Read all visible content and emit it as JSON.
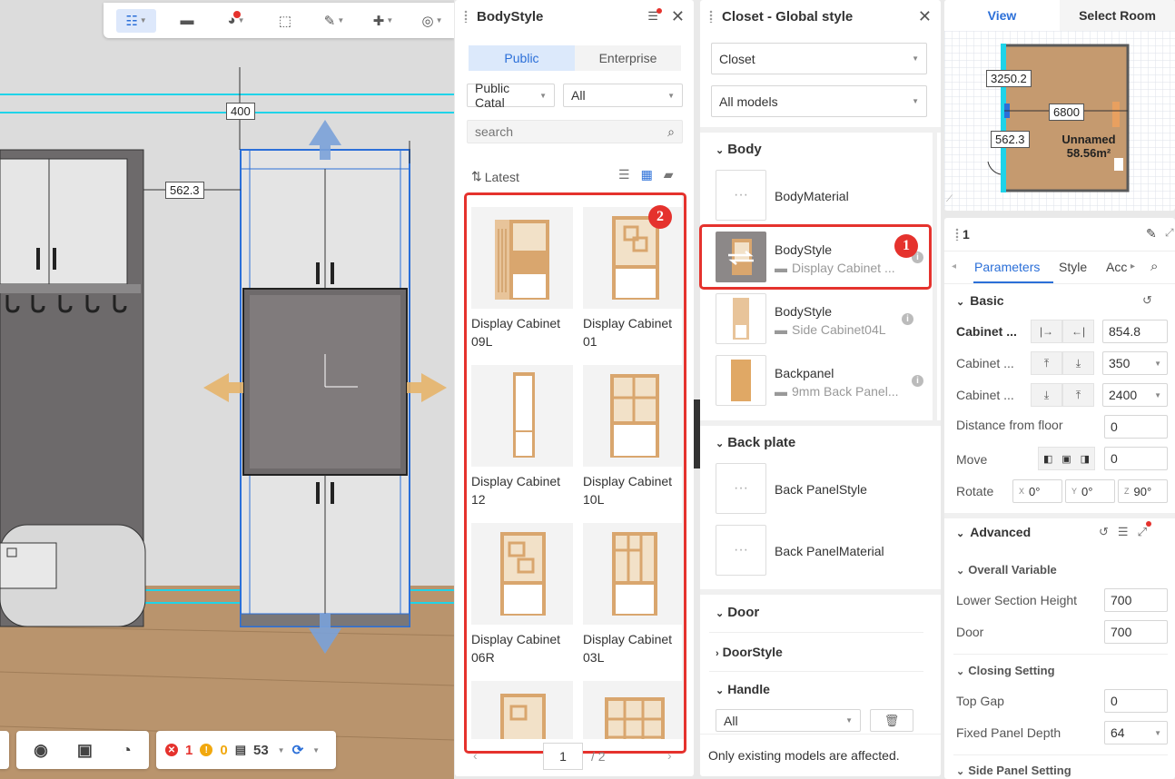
{
  "toolbar": {
    "icons": [
      "list-select-icon",
      "paint-roller-icon",
      "palette-icon",
      "frame-select-icon",
      "brush-icon",
      "puzzle-icon",
      "target-icon"
    ]
  },
  "viewport": {
    "dimensions": {
      "top_width": "400",
      "left_depth": "562.3"
    }
  },
  "bottombar": {
    "errors": "1",
    "warnings": "0",
    "count": "53"
  },
  "bodystyle_panel": {
    "title": "BodyStyle",
    "tabs": [
      "Public",
      "Enterprise"
    ],
    "active_tab": "Public",
    "catalog_select": "Public Catal",
    "filter_select": "All",
    "search_placeholder": "search",
    "sort_label": "Latest",
    "items": [
      {
        "label": "Display Cabinet 09L"
      },
      {
        "label": "Display Cabinet 01"
      },
      {
        "label": "Display Cabinet 12"
      },
      {
        "label": "Display Cabinet 10L"
      },
      {
        "label": "Display Cabinet 06R"
      },
      {
        "label": "Display Cabinet 03L"
      }
    ],
    "page_current": "1",
    "page_total": "/ 2",
    "badge": "2"
  },
  "closet_panel": {
    "title": "Closet - Global style",
    "type_select": "Closet",
    "model_select": "All models",
    "sections": {
      "body": "Body",
      "back_plate": "Back plate",
      "door": "Door",
      "door_style": "DoorStyle",
      "handle": "Handle"
    },
    "body_items": [
      {
        "name": "BodyMaterial",
        "sub": ""
      },
      {
        "name": "BodyStyle",
        "sub": "Display Cabinet ..."
      },
      {
        "name": "BodyStyle",
        "sub": "Side Cabinet04L"
      },
      {
        "name": "Backpanel",
        "sub": "9mm Back Panel..."
      }
    ],
    "back_items": [
      {
        "name": "Back PanelStyle"
      },
      {
        "name": "Back PanelMaterial"
      }
    ],
    "handle_select": "All",
    "footer": "Only existing models are affected.",
    "badge": "1"
  },
  "minimap": {
    "tabs": [
      "View",
      "Select Room"
    ],
    "active_tab": "View",
    "dim_left": "3250.2",
    "dim_center": "6800",
    "dim_depth": "562.3",
    "room_name": "Unnamed",
    "room_area": "58.56m²"
  },
  "properties": {
    "title": "1",
    "tabs": [
      "Parameters",
      "Style",
      "Acc"
    ],
    "active_tab": "Parameters",
    "basic_title": "Basic",
    "basic": [
      {
        "label": "Cabinet ...",
        "value": "854.8"
      },
      {
        "label": "Cabinet ...",
        "value": "350"
      },
      {
        "label": "Cabinet ...",
        "value": "2400"
      },
      {
        "label": "Distance from floor",
        "value": "0"
      },
      {
        "label": "Move",
        "value": "0"
      }
    ],
    "rotate_label": "Rotate",
    "rotate": {
      "x_label": "X",
      "x": "0°",
      "y_label": "Y",
      "y": "0°",
      "z_label": "Z",
      "z": "90°"
    },
    "advanced_title": "Advanced",
    "overall_title": "Overall Variable",
    "overall": [
      {
        "label": "Lower Section Height",
        "value": "700"
      },
      {
        "label": "Door",
        "value": "700"
      }
    ],
    "closing_title": "Closing Setting",
    "closing": [
      {
        "label": "Top Gap",
        "value": "0"
      },
      {
        "label": "Fixed Panel Depth",
        "value": "64"
      }
    ],
    "side_title": "Side Panel Setting"
  },
  "colors": {
    "accent": "#2b6fd8",
    "highlight": "#e5322d",
    "cyan_guide": "#1fd3e8"
  }
}
